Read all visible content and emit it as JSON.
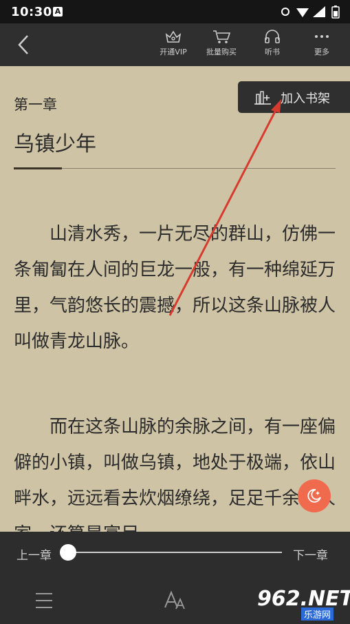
{
  "status_bar": {
    "time": "10:30",
    "notification_icon": "A"
  },
  "top_bar": {
    "back_icon": "chevron-left-icon",
    "items": [
      {
        "label": "开通VIP",
        "icon": "crown-icon"
      },
      {
        "label": "批量购买",
        "icon": "cart-icon"
      },
      {
        "label": "听书",
        "icon": "headphones-icon"
      },
      {
        "label": "更多",
        "icon": "more-dots-icon"
      }
    ]
  },
  "shelf_button": {
    "label": "加入书架",
    "icon": "bookshelf-add-icon"
  },
  "chapter": {
    "number": "第一章",
    "title": "乌镇少年",
    "paragraphs": [
      "山清水秀，一片无尽的群山，仿佛一条匍匐在人间的巨龙一般，有一种绵延万里，气韵悠长的震撼，所以这条山脉被人叫做青龙山脉。",
      "而在这条山脉的余脉之间，有一座偏僻的小镇，叫做乌镇，地处于极端，依山畔水，远远看去炊烟缭绕，足足千余户人家，还算是富足。"
    ]
  },
  "bottom_bar": {
    "prev_chapter": "上一章",
    "next_chapter": "下一章",
    "progress": 0.0,
    "icons": [
      "menu-icon",
      "font-size-icon"
    ]
  },
  "watermark": {
    "brand": "962.NET",
    "sub": "乐游网"
  },
  "colors": {
    "page_bg": "#cfc3a5",
    "bar_bg": "#2f2f2f",
    "text": "#2b2b2b",
    "fab": "#f06a4e",
    "annotation_arrow": "#d63b2e"
  }
}
